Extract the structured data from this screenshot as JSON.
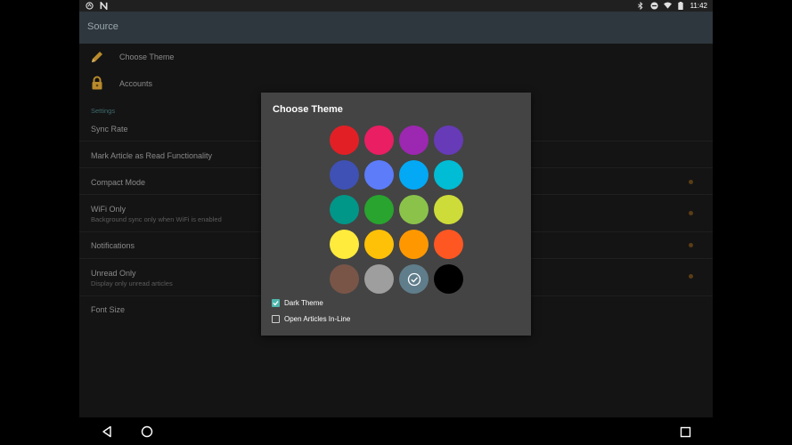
{
  "status_bar": {
    "time": "11:42",
    "left_icons": [
      "sync-icon",
      "n-icon"
    ],
    "right_icons": [
      "bluetooth-icon",
      "dnd-icon",
      "wifi-icon",
      "battery-icon"
    ]
  },
  "app_bar": {
    "title": "Source"
  },
  "list": {
    "items": [
      {
        "label": "Choose Theme",
        "icon": "pencil-icon"
      },
      {
        "label": "Accounts",
        "icon": "lock-icon"
      }
    ],
    "section_header": "Settings",
    "settings": [
      {
        "label": "Sync Rate",
        "sub": ""
      },
      {
        "label": "Mark Article as Read Functionality",
        "sub": ""
      },
      {
        "label": "Compact Mode",
        "sub": ""
      },
      {
        "label": "WiFi Only",
        "sub": "Background sync only when WiFi is enabled"
      },
      {
        "label": "Notifications",
        "sub": ""
      },
      {
        "label": "Unread Only",
        "sub": "Display only unread articles"
      },
      {
        "label": "Font Size",
        "sub": ""
      }
    ]
  },
  "dialog": {
    "title": "Choose Theme",
    "selected_color": "#607d8b",
    "colors": [
      "#e31f26",
      "#e91e63",
      "#9c27b0",
      "#673ab7",
      "#3f51b5",
      "#5c7cfa",
      "#03a9f4",
      "#00bcd4",
      "#009688",
      "#28a42f",
      "#8bc34a",
      "#cddc39",
      "#ffeb3b",
      "#ffc107",
      "#ff9800",
      "#ff5722",
      "#795548",
      "#9e9e9e",
      "#607d8b",
      "#000000"
    ],
    "dark_theme": {
      "label": "Dark Theme",
      "checked": true
    },
    "open_inline": {
      "label": "Open Articles In-Line",
      "checked": false
    }
  },
  "nav_bar": {
    "buttons": [
      "back-icon",
      "home-icon",
      "recents-icon"
    ]
  }
}
